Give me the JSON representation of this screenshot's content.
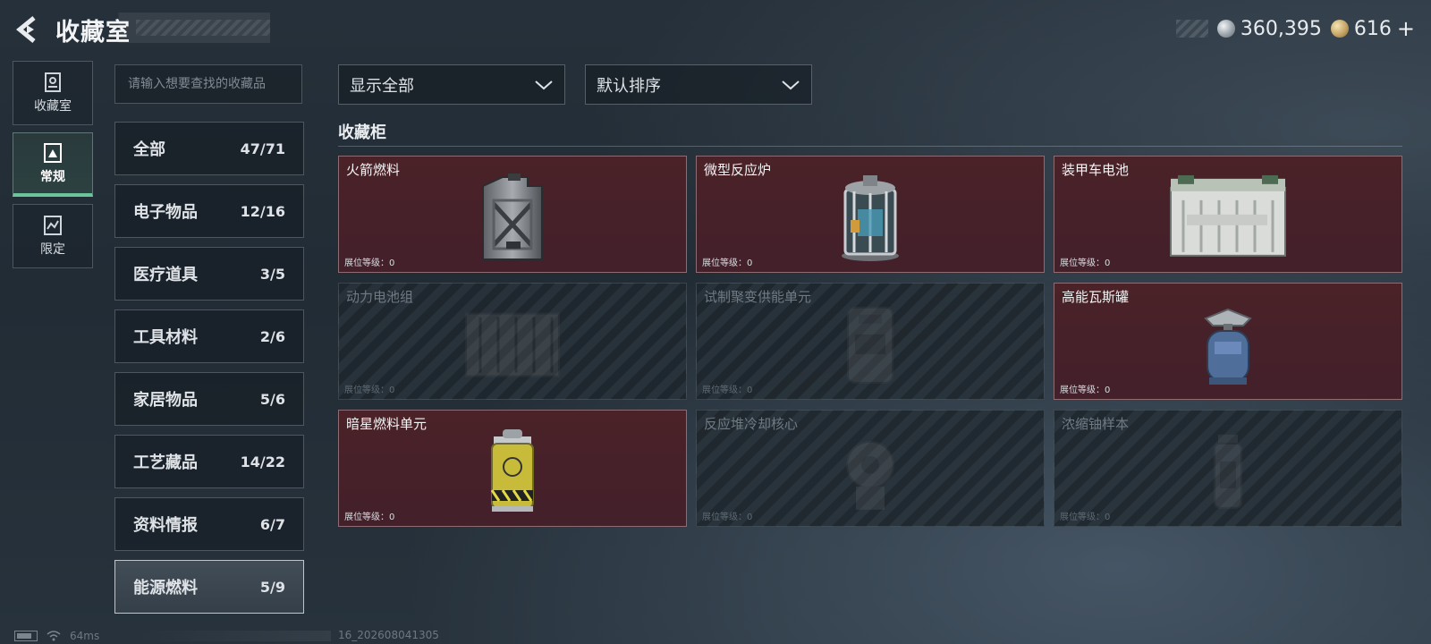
{
  "header": {
    "title": "收藏室",
    "currency": [
      {
        "icon": "silver-coin-icon",
        "value": "360,395"
      },
      {
        "icon": "gold-coin-icon",
        "value": "616"
      }
    ],
    "plus_label": "+"
  },
  "side_nav": [
    {
      "label": "收藏室",
      "icon": "collection-room-icon"
    },
    {
      "label": "常规",
      "icon": "regular-icon",
      "active": true
    },
    {
      "label": "限定",
      "icon": "limited-icon"
    }
  ],
  "search": {
    "placeholder": "请输入想要查找的收藏品",
    "value": ""
  },
  "categories": [
    {
      "name": "全部",
      "count": "47/71"
    },
    {
      "name": "电子物品",
      "count": "12/16"
    },
    {
      "name": "医疗道具",
      "count": "3/5"
    },
    {
      "name": "工具材料",
      "count": "2/6"
    },
    {
      "name": "家居物品",
      "count": "5/6"
    },
    {
      "name": "工艺藏品",
      "count": "14/22"
    },
    {
      "name": "资料情报",
      "count": "6/7"
    },
    {
      "name": "能源燃料",
      "count": "5/9",
      "selected": true
    }
  ],
  "filters": {
    "display": "显示全部",
    "sort": "默认排序"
  },
  "section_title": "收藏柜",
  "items": [
    {
      "name": "火箭燃料",
      "level": "展位等级：0",
      "owned": true,
      "icon": "fuel-canister-icon"
    },
    {
      "name": "微型反应炉",
      "level": "展位等级：0",
      "owned": true,
      "icon": "micro-reactor-icon"
    },
    {
      "name": "装甲车电池",
      "level": "展位等级：0",
      "owned": true,
      "icon": "vehicle-battery-icon"
    },
    {
      "name": "动力电池组",
      "level": "展位等级：0",
      "owned": false,
      "icon": "battery-pack-icon"
    },
    {
      "name": "试制聚变供能单元",
      "level": "展位等级：0",
      "owned": false,
      "icon": "fusion-unit-icon"
    },
    {
      "name": "高能瓦斯罐",
      "level": "展位等级：0",
      "owned": true,
      "icon": "gas-tank-icon"
    },
    {
      "name": "暗星燃料单元",
      "level": "展位等级：0",
      "owned": true,
      "icon": "fuel-cell-icon"
    },
    {
      "name": "反应堆冷却核心",
      "level": "展位等级：0",
      "owned": false,
      "icon": "cooling-core-icon"
    },
    {
      "name": "浓缩铀样本",
      "level": "展位等级：0",
      "owned": false,
      "icon": "uranium-sample-icon"
    }
  ],
  "status": {
    "ping": "64ms",
    "build": "16_202608041305"
  },
  "colors": {
    "owned_card": "#4a2228",
    "active_accent": "#6cc59a"
  }
}
